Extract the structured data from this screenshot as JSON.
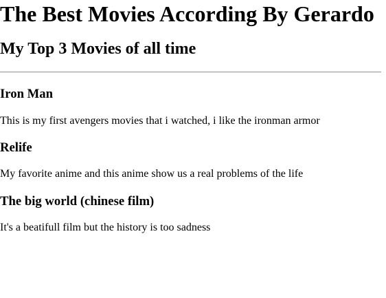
{
  "page": {
    "title": "The Best Movies According By Gerardo",
    "subtitle": "My Top 3 Movies of all time"
  },
  "movies": [
    {
      "title": "Iron Man",
      "description": "This is my first avengers movies that i watched, i like the ironman armor"
    },
    {
      "title": "Relife",
      "description": "My favorite anime and this anime show us a real problems of the life"
    },
    {
      "title": "The big world (chinese film)",
      "description": "It's a beatifull film but the history is too sadness"
    }
  ]
}
